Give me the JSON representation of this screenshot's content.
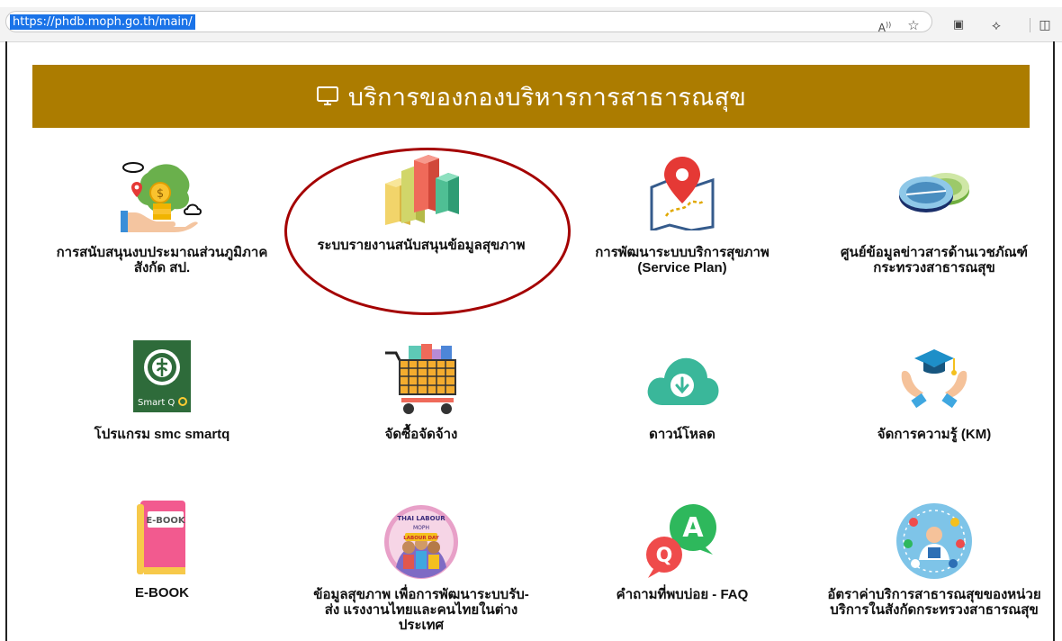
{
  "browser": {
    "url": "https://phdb.moph.go.th/main/",
    "icons": [
      "read-aloud-icon",
      "favorite-star-icon",
      "collections-icon",
      "extensions-icon",
      "split-screen-icon"
    ]
  },
  "banner": {
    "title": "บริการของกองบริหารการสาธารณสุข",
    "icon": "monitor-icon",
    "color": "#ac7c00"
  },
  "services": [
    {
      "label": "การสนับสนุนงบประมาณส่วนภูมิภาค\nสังกัด สป.",
      "icon": "budget-map-icon"
    },
    {
      "label": "ระบบรายงานสนับสนุนข้อมูลสุขภาพ",
      "icon": "bar-chart-icon"
    },
    {
      "label": "การพัฒนาระบบบริการสุขภาพ\n(Service Plan)",
      "icon": "map-pin-icon"
    },
    {
      "label": "ศูนย์ข้อมูลข่าวสารด้านเวชภัณฑ์\nกระทรวงสาธารณสุข",
      "icon": "pills-icon"
    },
    {
      "label": "โปรแกรม smc smartq",
      "icon": "smartq-logo-icon"
    },
    {
      "label": "จัดซื้อจัดจ้าง",
      "icon": "shopping-cart-icon"
    },
    {
      "label": "ดาวน์โหลด",
      "icon": "cloud-download-icon"
    },
    {
      "label": "จัดการความรู้ (KM)",
      "icon": "graduation-hands-icon"
    },
    {
      "label": "E-BOOK",
      "icon": "ebook-icon"
    },
    {
      "label": "ข้อมูลสุขภาพ เพื่อการพัฒนาระบบรับ-\nส่ง แรงงานไทยและคนไทยในต่าง\nประเทศ",
      "icon": "labour-day-icon"
    },
    {
      "label": "คำถามที่พบบ่อย - FAQ",
      "icon": "faq-bubbles-icon"
    },
    {
      "label": "อัตราค่าบริการสาธารณสุขของหน่วย\nบริการในสังกัดกระทรวงสาธารณสุข",
      "icon": "health-services-icon"
    }
  ],
  "ebook_badge": "E-BOOK",
  "smartq_badge": "Smart Q",
  "faq_letters": {
    "a": "A",
    "q": "Q"
  },
  "labour_badge": {
    "top": "THAI LABOUR",
    "mid": "MOPH",
    "bottom": "LABOUR DAY"
  }
}
